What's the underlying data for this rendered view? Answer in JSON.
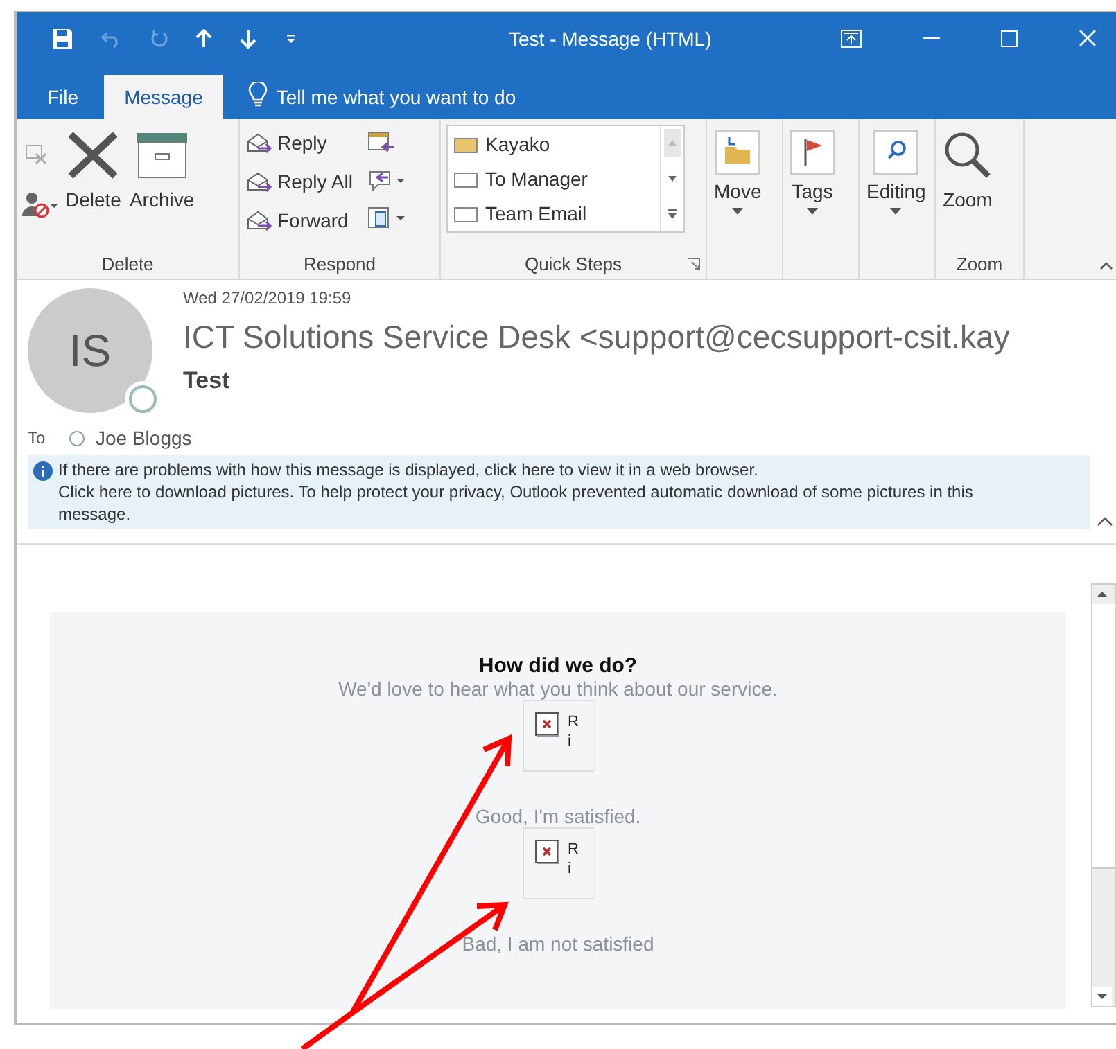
{
  "window": {
    "title": "Test  -  Message (HTML)"
  },
  "tabs": [
    {
      "label": "File",
      "selected": false
    },
    {
      "label": "Message",
      "selected": true
    }
  ],
  "tell_me": {
    "placeholder": "Tell me what you want to do"
  },
  "ribbon": {
    "groups": [
      {
        "kind": "delete",
        "label": "Delete",
        "buttons": [
          "Delete",
          "Archive"
        ]
      },
      {
        "kind": "respond",
        "label": "Respond",
        "buttons": [
          "Reply",
          "Reply All",
          "Forward"
        ]
      },
      {
        "kind": "quicksteps",
        "label": "Quick Steps",
        "items": [
          "Kayako",
          "To Manager",
          "Team Email"
        ]
      },
      {
        "kind": "single",
        "buttons": [
          "Move"
        ]
      },
      {
        "kind": "single",
        "buttons": [
          "Tags"
        ]
      },
      {
        "kind": "single",
        "buttons": [
          "Editing"
        ]
      },
      {
        "kind": "zoom",
        "label": "Zoom",
        "buttons": [
          "Zoom"
        ]
      }
    ]
  },
  "message": {
    "date": "Wed 27/02/2019 19:59",
    "sender": "ICT Solutions Service Desk <support@cecsupport-csit.kay",
    "subject": "Test",
    "avatar": "IS",
    "to_label": "To",
    "recipient": "Joe Bloggs",
    "info_lines": [
      "If there are problems with how this message is displayed, click here to view it in a web browser.",
      "Click here to download pictures. To help protect your privacy, Outlook prevented automatic download of some pictures in this message."
    ]
  },
  "survey": {
    "title": "How did we do?",
    "subtitle": "We'd love to hear what you think about our service.",
    "options": [
      {
        "alt_lines": [
          "R",
          "i"
        ],
        "label": "Good, I'm satisfied."
      },
      {
        "alt_lines": [
          "R",
          "i"
        ],
        "label": "Bad, I am not satisfied"
      }
    ]
  }
}
